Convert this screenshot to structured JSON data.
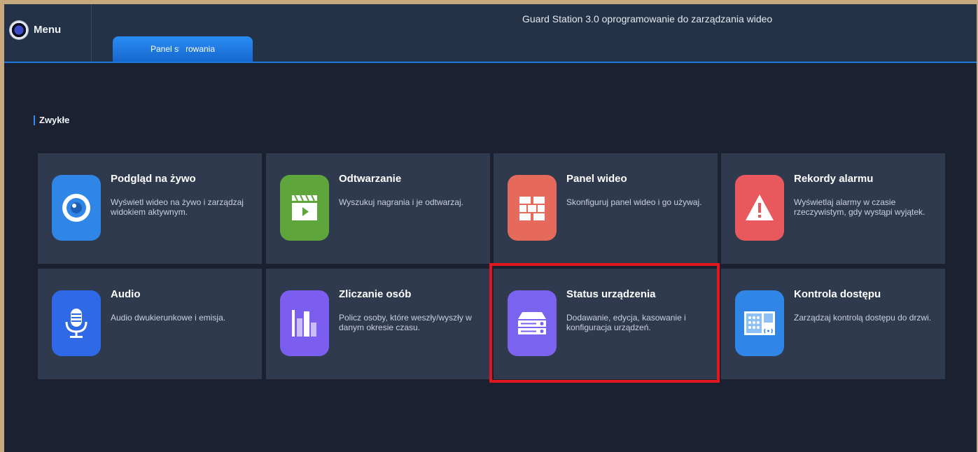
{
  "header": {
    "menu_label": "Menu",
    "app_title": "Guard Station 3.0 oprogramowanie do zarządzania wideo",
    "tab_label": "Panel sterowania"
  },
  "section": {
    "title": "Zwykłe"
  },
  "cards": [
    {
      "title": "Podgląd na żywo",
      "desc": "Wyświetl wideo na żywo i zarządzaj widokiem aktywnym.",
      "icon": "camera-lens-icon",
      "color": "#2f86e6"
    },
    {
      "title": "Odtwarzanie",
      "desc": "Wyszukuj nagrania i je odtwarzaj.",
      "icon": "clapperboard-icon",
      "color": "#5ea63b"
    },
    {
      "title": "Panel wideo",
      "desc": "Skonfiguruj panel wideo i go używaj.",
      "icon": "video-wall-icon",
      "color": "#e56a5c"
    },
    {
      "title": "Rekordy alarmu",
      "desc": "Wyświetlaj alarmy w czasie rzeczywistym, gdy wystąpi wyjątek.",
      "icon": "alarm-warning-icon",
      "color": "#e8585c"
    },
    {
      "title": "Audio",
      "desc": "Audio dwukierunkowe i emisja.",
      "icon": "microphone-icon",
      "color": "#2e6ae7"
    },
    {
      "title": "Zliczanie osób",
      "desc": "Policz osoby, które weszły/wyszły w danym okresie czasu.",
      "icon": "bar-chart-icon",
      "color": "#7b5ef0"
    },
    {
      "title": "Status urządzenia",
      "desc": "Dodawanie, edycja, kasowanie i konfiguracja urządzeń.",
      "icon": "server-device-icon",
      "color": "#7a63ee"
    },
    {
      "title": "Kontrola dostępu",
      "desc": "Zarządzaj kontrolą dostępu do drzwi.",
      "icon": "access-control-panel-icon",
      "color": "#2f86e6"
    }
  ]
}
